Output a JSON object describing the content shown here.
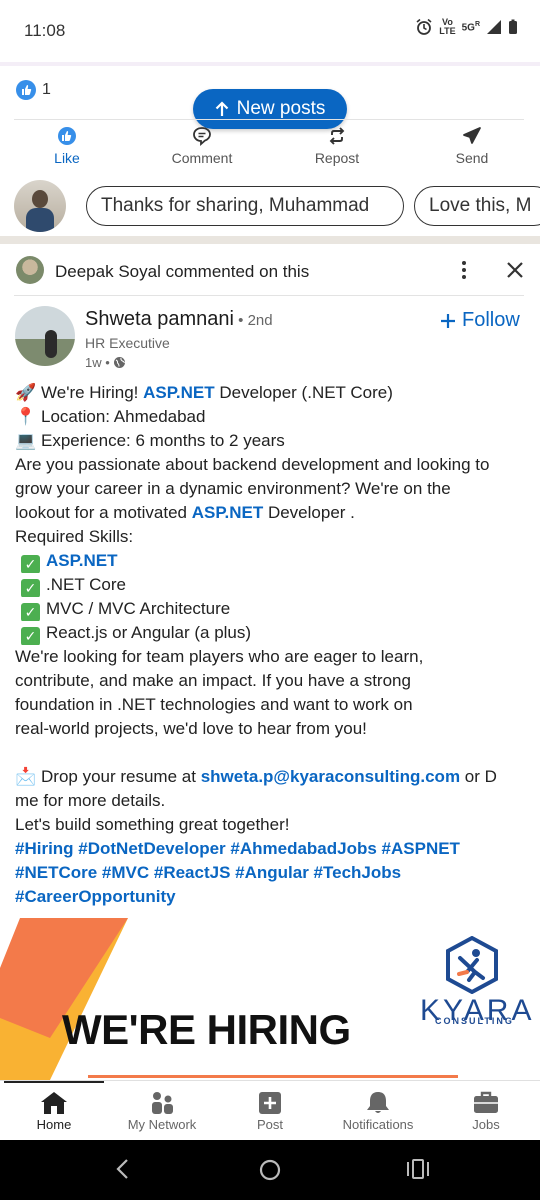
{
  "status_bar": {
    "time": "11:08",
    "volte_top": "Vo",
    "volte_bottom": "LTE",
    "network": "5G",
    "network_sup": "R"
  },
  "reactions": {
    "count": "1"
  },
  "new_posts": {
    "label": "New posts"
  },
  "actions": {
    "like": "Like",
    "comment": "Comment",
    "repost": "Repost",
    "send": "Send"
  },
  "quick_replies": [
    "Thanks for sharing, Muhammad",
    "Love this, M"
  ],
  "header": {
    "text": "Deepak Soyal commented on this"
  },
  "author": {
    "name": "Shweta pamnani",
    "degree": " • 2nd",
    "title": "HR Executive",
    "time": "1w •",
    "follow": "Follow"
  },
  "post": {
    "l1_pre": "We're Hiring! ",
    "l1_link": "ASP.NET",
    "l1_post": " Developer (.NET Core)",
    "l2": "Location: Ahmedabad",
    "l3": "Experience: 6 months to 2 years",
    "l4": "Are you passionate about backend development and looking to",
    "l5": "grow your career in a dynamic environment? We're on the",
    "l6_pre": "lookout for a motivated ",
    "l6_link": "ASP.NET",
    "l6_post": " Developer .",
    "l7": "Required Skills:",
    "skill1": "ASP.NET",
    "skill2": ".NET Core",
    "skill3": "MVC / MVC Architecture",
    "skill4": "React.js or Angular (a plus)",
    "l12": "We're looking for team players who are eager to learn,",
    "l13": "contribute, and make an impact. If you have a strong",
    "l14": "foundation in .NET technologies and want to work on",
    "l15": "real-world projects, we'd love to hear from you!",
    "l17_pre": "Drop your resume at ",
    "l17_link": "shweta.p@kyaraconsulting.com",
    "l17_post": " or D",
    "l18": "me for more details.",
    "l19": " Let's build something great together!",
    "tags1": "#Hiring #DotNetDeveloper #AhmedabadJobs #ASPNET",
    "tags2": "#NETCore #MVC #ReactJS #Angular #TechJobs",
    "tags3": "#CareerOpportunity"
  },
  "banner": {
    "title": "WE'RE HIRING",
    "brand": "KYARA",
    "brand_sub": "CONSULTING"
  },
  "bottom_nav": {
    "home": "Home",
    "network": "My Network",
    "post": "Post",
    "notifications": "Notifications",
    "jobs": "Jobs"
  },
  "colors": {
    "accent": "#0a66c2",
    "check": "#4caf50",
    "brand": "#1e4a92",
    "banner_orange": "#f37a4a",
    "banner_yellow": "#f9b233"
  }
}
